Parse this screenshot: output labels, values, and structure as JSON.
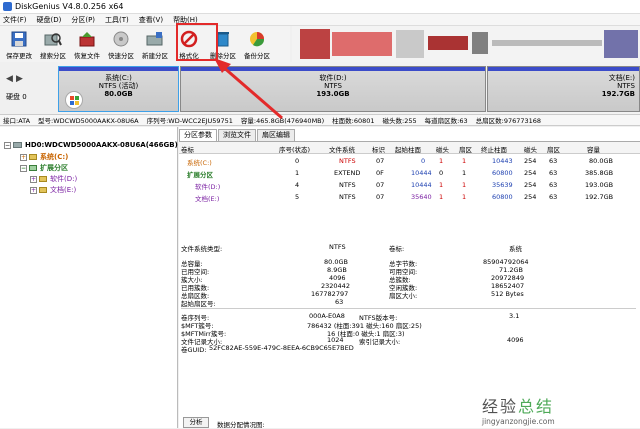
{
  "window": {
    "title": "DiskGenius V4.8.0.256 x64"
  },
  "menu": [
    "文件(F)",
    "硬盘(D)",
    "分区(P)",
    "工具(T)",
    "查看(V)",
    "帮助(H)"
  ],
  "toolbar": [
    {
      "label": "保存更改",
      "icon": "save-icon"
    },
    {
      "label": "搜索分区",
      "icon": "search-icon"
    },
    {
      "label": "恢复文件",
      "icon": "recover-icon"
    },
    {
      "label": "快速分区",
      "icon": "quick-partition-icon"
    },
    {
      "label": "新建分区",
      "icon": "new-partition-icon"
    },
    {
      "label": "格式化",
      "icon": "format-icon"
    },
    {
      "label": "删除分区",
      "icon": "delete-icon"
    },
    {
      "label": "备份分区",
      "icon": "backup-icon"
    }
  ],
  "disk_nav": {
    "label": "硬盘 0"
  },
  "disk_map": {
    "c": {
      "name": "系统(C:)",
      "fs": "NTFS (活动)",
      "size": "80.0GB"
    },
    "d": {
      "name": "软件(D:)",
      "fs": "NTFS",
      "size": "193.0GB"
    },
    "e": {
      "name": "文档(E:)",
      "fs": "NTFS",
      "size": "192.7GB"
    }
  },
  "infobar": [
    "接口:ATA",
    "型号:WDCWD5000AAKX-08U6A",
    "序列号:WD-WCC2EJU59751",
    "容量:465.8GB(476940MB)",
    "柱面数:60801",
    "磁头数:255",
    "每道扇区数:63",
    "总扇区数:976773168"
  ],
  "tree": {
    "disk": "HD0:WDCWD5000AAKX-08U6A(466GB)",
    "items": [
      {
        "label": "系统(C:)"
      },
      {
        "label": "扩展分区"
      },
      {
        "label": "软件(D:)"
      },
      {
        "label": "文档(E:)"
      }
    ]
  },
  "tabs": [
    "分区参数",
    "浏览文件",
    "扇区编辑"
  ],
  "partition_table": {
    "headers": [
      "卷标",
      "序号(状态)",
      "文件系统",
      "标识",
      "起始柱面",
      "磁头",
      "扇区",
      "终止柱面",
      "磁头",
      "扇区",
      "容量"
    ],
    "rows": [
      [
        "系统(C:)",
        "0",
        "NTFS",
        "07",
        "0",
        "1",
        "1",
        "10443",
        "254",
        "63",
        "80.0GB"
      ],
      [
        "扩展分区",
        "1",
        "EXTEND",
        "0F",
        "10444",
        "0",
        "1",
        "60800",
        "254",
        "63",
        "385.8GB"
      ],
      [
        "软件(D:)",
        "4",
        "NTFS",
        "07",
        "10444",
        "1",
        "1",
        "35639",
        "254",
        "63",
        "193.0GB"
      ],
      [
        "文档(E:)",
        "5",
        "NTFS",
        "07",
        "35640",
        "1",
        "1",
        "60800",
        "254",
        "63",
        "192.7GB"
      ]
    ]
  },
  "details": {
    "fs_type_label": "文件系统类型:",
    "fs_type": "NTFS",
    "vol_label_label": "卷标:",
    "vol_label": "系统",
    "left": [
      {
        "k": "总容量:",
        "v": "80.0GB"
      },
      {
        "k": "已用空间:",
        "v": "8.9GB"
      },
      {
        "k": "簇大小:",
        "v": "4096"
      },
      {
        "k": "已用簇数:",
        "v": "2320442"
      },
      {
        "k": "总扇区数:",
        "v": "167782797"
      },
      {
        "k": "起始扇区号:",
        "v": "63"
      }
    ],
    "right": [
      {
        "k": "总字节数:",
        "v": "85904792064"
      },
      {
        "k": "可用空间:",
        "v": "71.2GB"
      },
      {
        "k": "总簇数:",
        "v": "20972849"
      },
      {
        "k": "空闲簇数:",
        "v": "18652407"
      },
      {
        "k": "扇区大小:",
        "v": "512 Bytes"
      }
    ],
    "serial_label": "卷序列号:",
    "serial": "000A-E0A8",
    "ntfs_ver_label": "NTFS版本号:",
    "ntfs_ver": "3.1",
    "mft_label": "$MFT簇号:",
    "mft": "786432 (柱面:391 磁头:160 扇区:25)",
    "mftmirr_label": "$MFTMirr簇号:",
    "mftmirr": "16 (柱面:0 磁头:1 扇区:3)",
    "frs_label": "文件记录大小:",
    "frs": "1024",
    "idx_label": "索引记录大小:",
    "idx": "4096",
    "guid_label": "卷GUID:",
    "guid": "52FC82AE-559E-479C-8EEA-6CB9C65E7BED"
  },
  "analyze": {
    "button": "分析",
    "label": "数据分配情况图:"
  },
  "watermark": {
    "line1a": "经验",
    "line1b": "总结",
    "line2": "jingyanzongjie.com"
  },
  "colors": {
    "accent_red": "#e32a2a",
    "partition_blue": "#3b4cc9",
    "selection_blue": "#3ea0e8"
  }
}
